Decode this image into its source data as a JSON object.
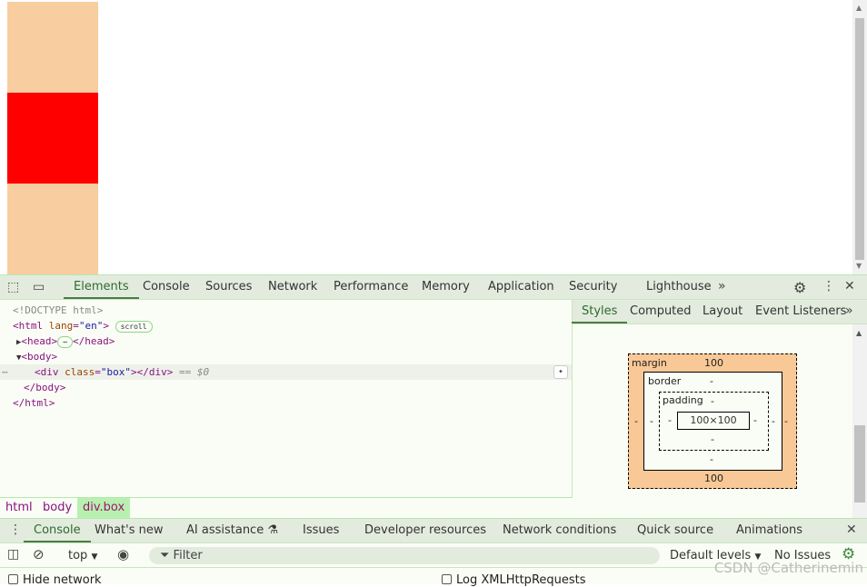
{
  "viewport": {
    "colors": {
      "margin": "#f8cda0",
      "box": "#ff0000"
    }
  },
  "devtools": {
    "tabs": [
      "Elements",
      "Console",
      "Sources",
      "Network",
      "Performance",
      "Memory",
      "Application",
      "Security",
      "Lighthouse"
    ],
    "active_tab": "Elements",
    "dom": {
      "doctype": "<!DOCTYPE html>",
      "html_open": "<html",
      "lang_attr": "lang",
      "lang_val": "\"en\"",
      "scroll_badge": "scroll",
      "head_open": "<head>",
      "ellipsis": "⋯",
      "head_close": "</head>",
      "body_open": "<body>",
      "div_open": "<div",
      "class_attr": "class",
      "class_val": "\"box\"",
      "div_close": "></div>",
      "selected_marker": "== $0",
      "body_close": "</body>",
      "html_close": "</html>",
      "gt": ">",
      "eq": "="
    },
    "breadcrumbs": [
      "html",
      "body",
      "div.box"
    ],
    "styles_tabs": [
      "Styles",
      "Computed",
      "Layout",
      "Event Listeners"
    ],
    "box_model": {
      "margin_label": "margin",
      "margin_top": "100",
      "margin_bottom": "100",
      "margin_left": "-",
      "margin_right": "-",
      "border_label": "border",
      "border_top": "-",
      "border_bottom": "-",
      "border_left": "-",
      "border_right": "-",
      "padding_label": "padding",
      "padding_top": "-",
      "padding_bottom": "-",
      "padding_left": "-",
      "padding_right": "-",
      "content": "100×100"
    },
    "drawer_tabs": [
      "Console",
      "What's new",
      "AI assistance",
      "Issues",
      "Developer resources",
      "Network conditions",
      "Quick source",
      "Animations"
    ],
    "console": {
      "context": "top",
      "filter_placeholder": "Filter",
      "levels": "Default levels",
      "issues": "No Issues",
      "hide_network": "Hide network",
      "log_xhr": "Log XMLHttpRequests"
    }
  },
  "watermark": "CSDN @Catherinemin"
}
